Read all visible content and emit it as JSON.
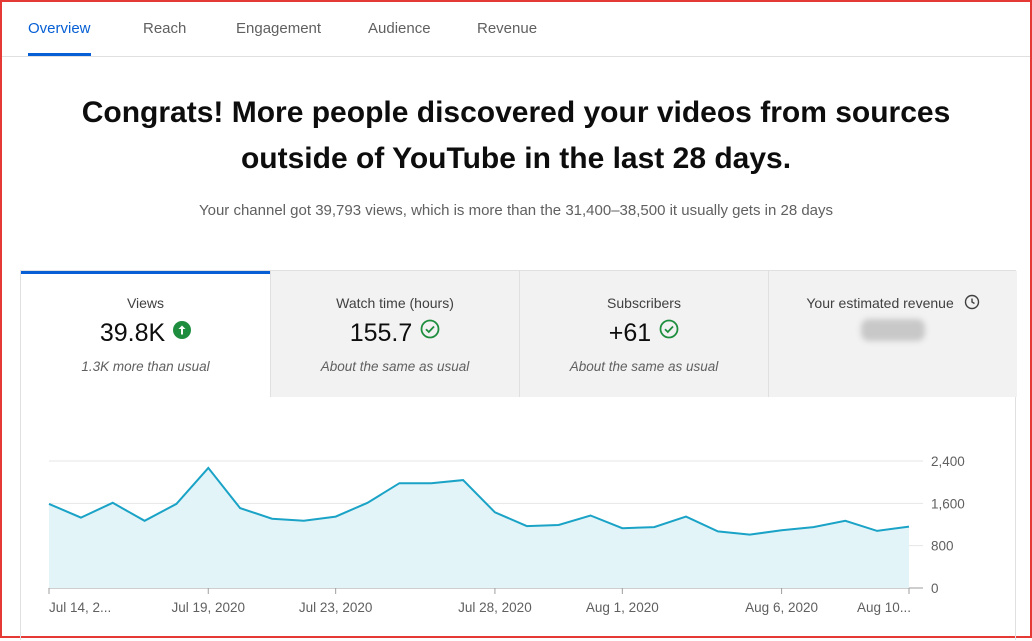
{
  "tabs": [
    {
      "label": "Overview",
      "active": true
    },
    {
      "label": "Reach",
      "active": false
    },
    {
      "label": "Engagement",
      "active": false
    },
    {
      "label": "Audience",
      "active": false
    },
    {
      "label": "Revenue",
      "active": false
    }
  ],
  "headline": {
    "line1": "Congrats! More people discovered your videos from sources",
    "line2": "outside of YouTube in the last 28 days."
  },
  "subline": "Your channel got 39,793 views, which is more than the 31,400–38,500 it usually gets in 28 days",
  "metrics": [
    {
      "label": "Views",
      "value": "39.8K",
      "note": "1.3K more than usual",
      "status_icon": "arrow-up-circle-icon",
      "status_color": "#1e8e3e",
      "active": true
    },
    {
      "label": "Watch time (hours)",
      "value": "155.7",
      "note": "About the same as usual",
      "status_icon": "check-circle-icon",
      "status_color": "#1e8e3e",
      "active": false
    },
    {
      "label": "Subscribers",
      "value": "+61",
      "note": "About the same as usual",
      "status_icon": "check-circle-icon",
      "status_color": "#1e8e3e",
      "active": false
    },
    {
      "label": "Your estimated revenue",
      "value": "",
      "note": "",
      "info_icon": "clock-icon",
      "value_redacted": true,
      "active": false
    }
  ],
  "colors": {
    "accent": "#065fd4",
    "line": "#1aa3c6",
    "fill": "#e3f4f8",
    "positive": "#1e8e3e"
  },
  "chart_data": {
    "type": "area",
    "x": [
      "Jul 14",
      "Jul 15",
      "Jul 16",
      "Jul 17",
      "Jul 18",
      "Jul 19",
      "Jul 20",
      "Jul 21",
      "Jul 22",
      "Jul 23",
      "Jul 24",
      "Jul 25",
      "Jul 26",
      "Jul 27",
      "Jul 28",
      "Jul 29",
      "Jul 30",
      "Jul 31",
      "Aug 1",
      "Aug 2",
      "Aug 3",
      "Aug 4",
      "Aug 5",
      "Aug 6",
      "Aug 7",
      "Aug 8",
      "Aug 9",
      "Aug 10"
    ],
    "series": [
      {
        "values": [
          1590,
          1330,
          1610,
          1270,
          1590,
          2270,
          1510,
          1310,
          1270,
          1350,
          1610,
          1980,
          1980,
          2040,
          1430,
          1170,
          1190,
          1370,
          1130,
          1150,
          1350,
          1070,
          1010,
          1090,
          1150,
          1270,
          1080,
          1160
        ]
      }
    ],
    "xtick_labels": [
      "Jul 14, 2...",
      "Jul 19, 2020",
      "Jul 23, 2020",
      "Jul 28, 2020",
      "Aug 1, 2020",
      "Aug 6, 2020",
      "Aug 10..."
    ],
    "xtick_dates": [
      "Jul 14",
      "Jul 19",
      "Jul 23",
      "Jul 28",
      "Aug 1",
      "Aug 6",
      "Aug 10"
    ],
    "yticks": [
      0,
      800,
      1600,
      2400
    ],
    "ytick_labels": [
      "0",
      "800",
      "1,600",
      "2,400"
    ],
    "ylim": [
      0,
      2400
    ],
    "grid": true,
    "y_axis_side": "right"
  }
}
